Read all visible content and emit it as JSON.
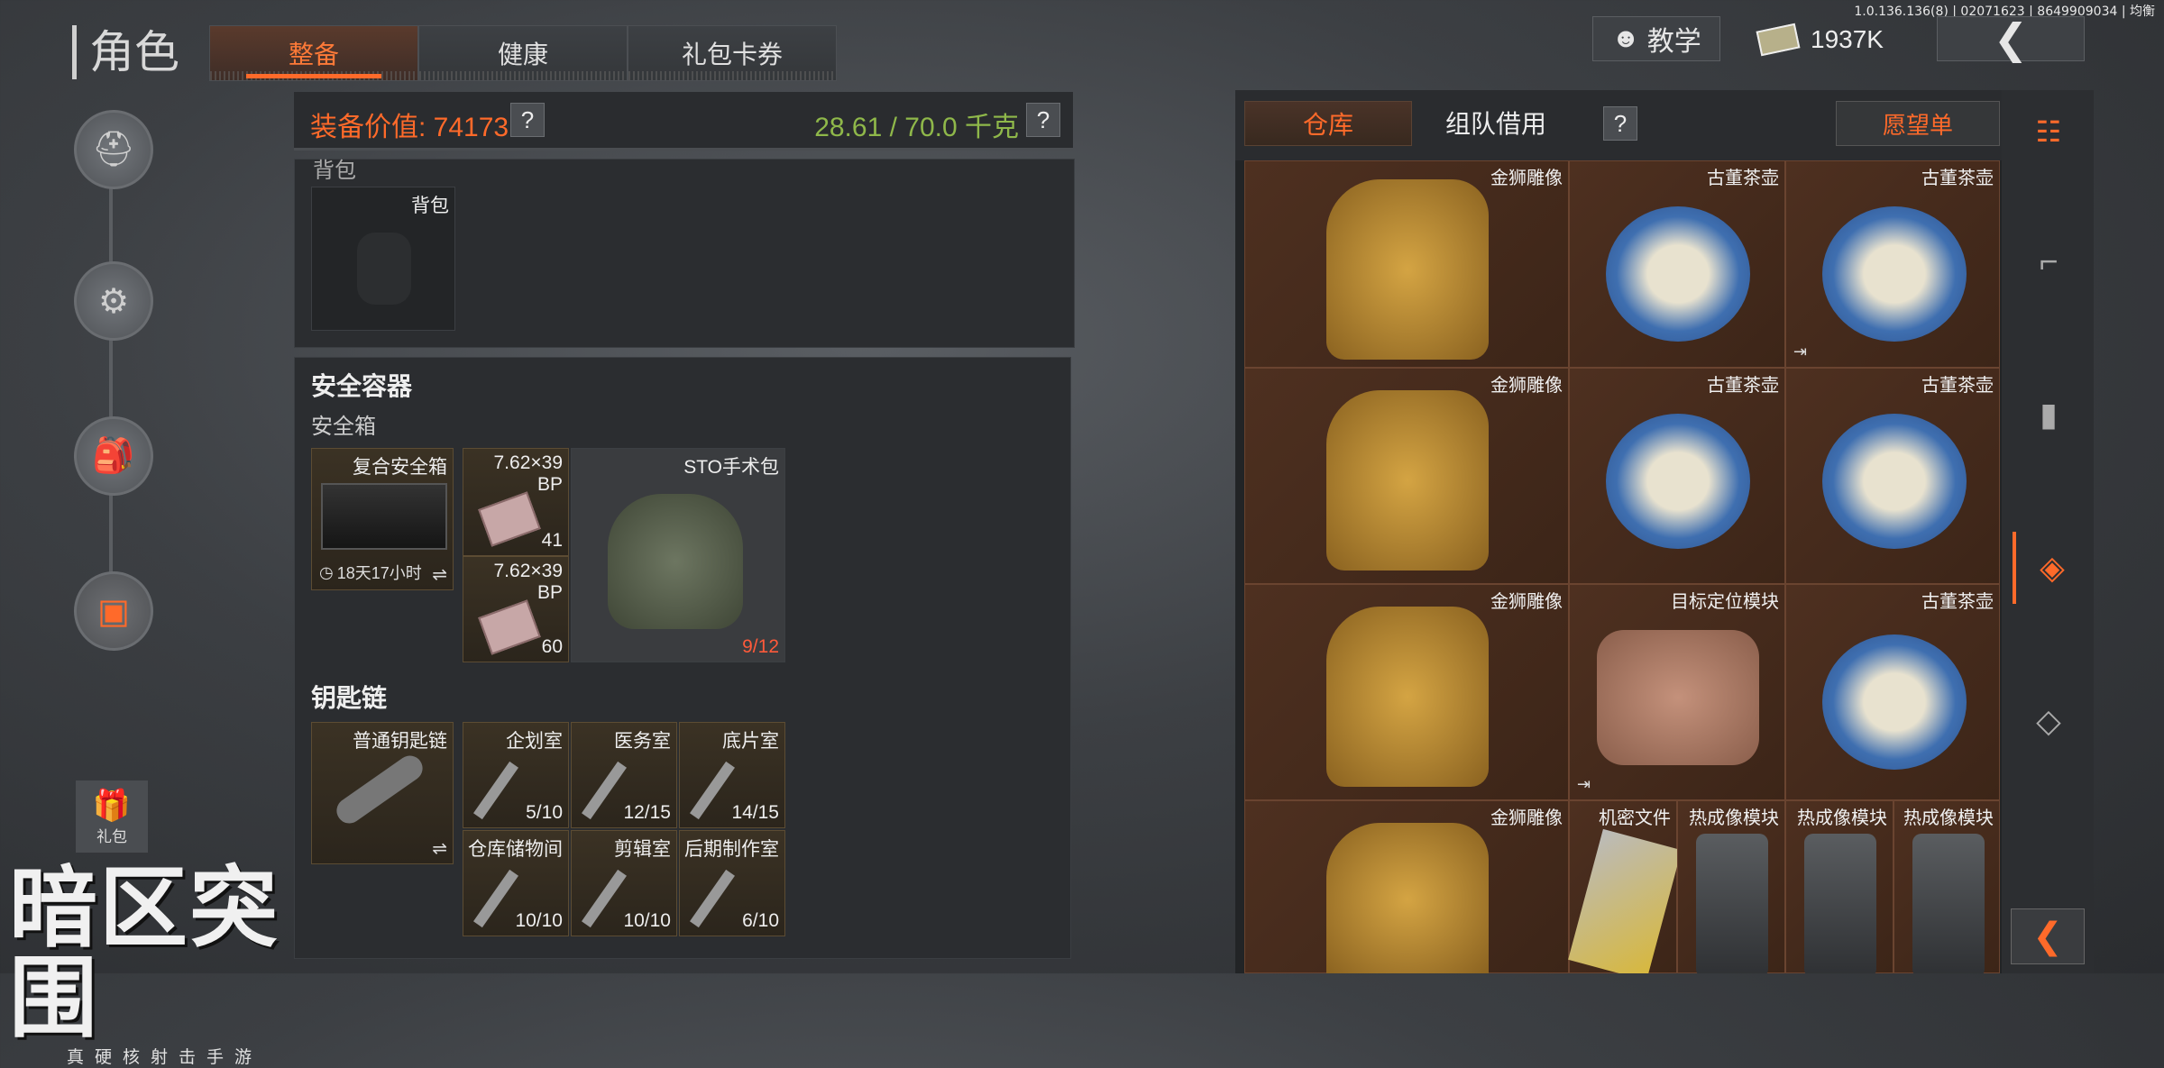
{
  "version": "1.0.136.136(8) | 02071623 | 8649909034 | 均衡",
  "page_title": "角色",
  "tabs": [
    "整备",
    "健康",
    "礼包卡券"
  ],
  "top": {
    "tutorial_label": "教学",
    "currency": "1937K"
  },
  "left_rail": {
    "gift_label": "礼包"
  },
  "equip": {
    "value_label": "装备价值: 74173",
    "weight": "28.61 / 70.0 千克",
    "help": "?"
  },
  "backpack": {
    "section": "背包",
    "slot_label": "背包"
  },
  "safe": {
    "title": "安全容器",
    "sub": "安全箱",
    "box_label": "复合安全箱",
    "box_timer": "18天17小时",
    "ammo": [
      {
        "name": "7.62×39 BP",
        "count": "41"
      },
      {
        "name": "7.62×39 BP",
        "count": "60"
      }
    ],
    "bag": {
      "name": "STO手术包",
      "durability": "9/12"
    }
  },
  "keys": {
    "title": "钥匙链",
    "chain_label": "普通钥匙链",
    "items": [
      {
        "name": "企划室",
        "uses": "5/10"
      },
      {
        "name": "医务室",
        "uses": "12/15"
      },
      {
        "name": "底片室",
        "uses": "14/15"
      },
      {
        "name": "仓库储物间",
        "uses": "10/10"
      },
      {
        "name": "剪辑室",
        "uses": "10/10"
      },
      {
        "name": "后期制作室",
        "uses": "6/10"
      }
    ]
  },
  "warehouse": {
    "tab_storage": "仓库",
    "tab_team": "组队借用",
    "help": "?",
    "wishlist": "愿望单",
    "cells": [
      "金狮雕像",
      "古董茶壶",
      "古董茶壶",
      "金狮雕像",
      "古董茶壶",
      "古董茶壶",
      "金狮雕像",
      "目标定位模块",
      "古董茶壶",
      "金狮雕像",
      "机密文件",
      "热成像模块",
      "热成像模块",
      "热成像模块"
    ]
  },
  "colors": {
    "accent": "#ff6a2a",
    "weight_green": "#8fb84a",
    "warehouse_bg": "#4a2d1f"
  }
}
